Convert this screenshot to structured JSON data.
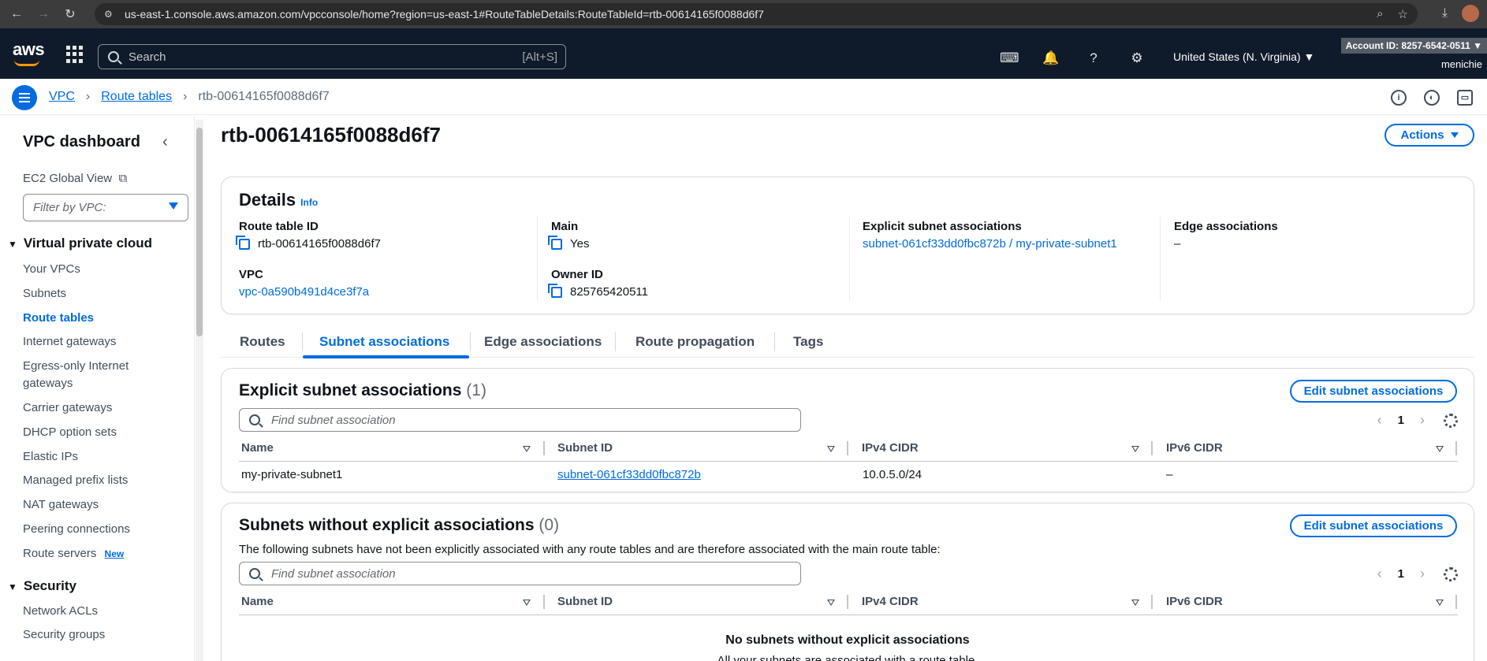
{
  "browser": {
    "url": "us-east-1.console.aws.amazon.com/vpcconsole/home?region=us-east-1#RouteTableDetails:RouteTableId=rtb-00614165f0088d6f7"
  },
  "topbar": {
    "logo": "aws",
    "search_placeholder": "Search",
    "search_shortcut": "[Alt+S]",
    "region": "United States (N. Virginia) ▼",
    "account": "Account ID: 8257-6542-0511 ▼",
    "user": "menichie"
  },
  "breadcrumb": {
    "items": [
      "VPC",
      "Route tables"
    ],
    "current": "rtb-00614165f0088d6f7"
  },
  "sidebar": {
    "title": "VPC dashboard",
    "global_view": "EC2 Global View",
    "filter_placeholder": "Filter by VPC:",
    "section_vpc": "Virtual private cloud",
    "items": [
      "Your VPCs",
      "Subnets",
      "Route tables",
      "Internet gateways",
      "Egress-only Internet",
      "gateways",
      "Carrier gateways",
      "DHCP option sets",
      "Elastic IPs",
      "Managed prefix lists",
      "NAT gateways",
      "Peering connections",
      "Route servers"
    ],
    "new_badge": "New",
    "section_security": "Security",
    "security_items": [
      "Network ACLs",
      "Security groups"
    ]
  },
  "page": {
    "title": "rtb-00614165f0088d6f7",
    "actions_label": "Actions"
  },
  "details": {
    "heading": "Details",
    "info": "Info",
    "route_table_id_label": "Route table ID",
    "route_table_id": "rtb-00614165f0088d6f7",
    "vpc_label": "VPC",
    "vpc": "vpc-0a590b491d4ce3f7a",
    "main_label": "Main",
    "main": "Yes",
    "owner_label": "Owner ID",
    "owner": "825765420511",
    "explicit_label": "Explicit subnet associations",
    "explicit": "subnet-061cf33dd0fbc872b / my-private-subnet1",
    "edge_label": "Edge associations",
    "edge": "–"
  },
  "tabs": [
    "Routes",
    "Subnet associations",
    "Edge associations",
    "Route propagation",
    "Tags"
  ],
  "explicit_table": {
    "title": "Explicit subnet associations",
    "count": "(1)",
    "edit_label": "Edit subnet associations",
    "find_placeholder": "Find subnet association",
    "page": "1",
    "columns": [
      "Name",
      "Subnet ID",
      "IPv4 CIDR",
      "IPv6 CIDR"
    ],
    "rows": [
      {
        "name": "my-private-subnet1",
        "subnet_id": "subnet-061cf33dd0fbc872b",
        "ipv4": "10.0.5.0/24",
        "ipv6": "–"
      }
    ]
  },
  "nonexplicit_table": {
    "title": "Subnets without explicit associations",
    "count": "(0)",
    "edit_label": "Edit subnet associations",
    "description": "The following subnets have not been explicitly associated with any route tables and are therefore associated with the main route table:",
    "find_placeholder": "Find subnet association",
    "page": "1",
    "columns": [
      "Name",
      "Subnet ID",
      "IPv4 CIDR",
      "IPv6 CIDR"
    ],
    "empty_title": "No subnets without explicit associations",
    "empty_sub": "All your subnets are associated with a route table."
  },
  "colors": {
    "link": "#006ce0",
    "topbar": "#0f1b2a",
    "text": "#0f141a"
  }
}
